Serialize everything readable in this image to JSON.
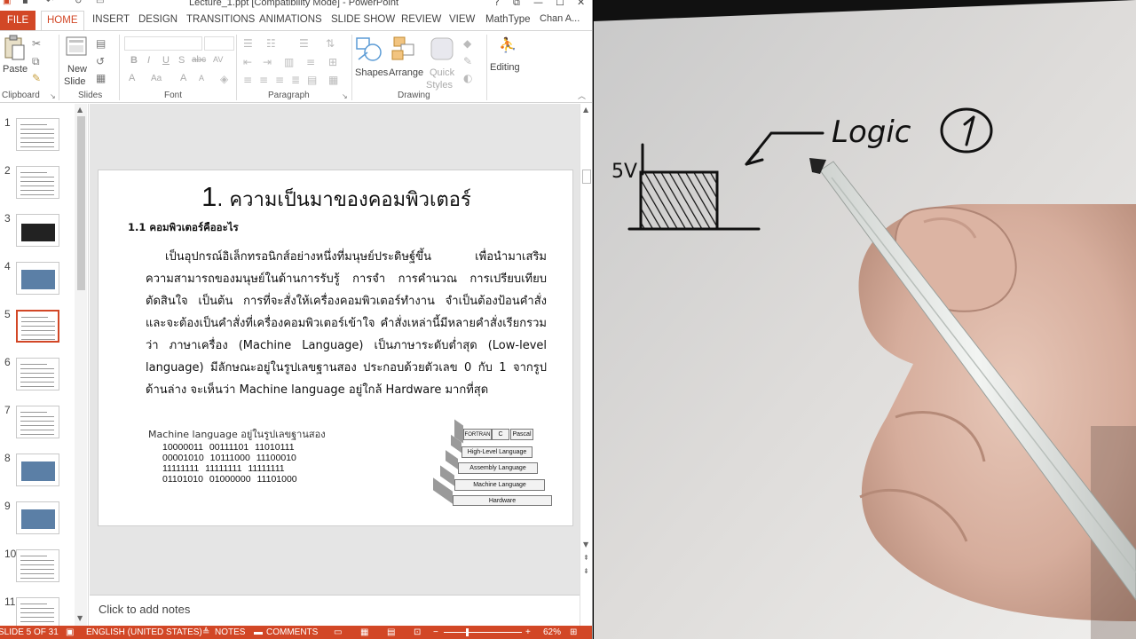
{
  "window": {
    "title": "Lecture_1.ppt [Compatibility Mode] - PowerPoint",
    "controls": {
      "help": "?",
      "restore_ribbon": "⧉",
      "minimize": "—",
      "maximize": "☐",
      "close": "✕"
    }
  },
  "tabs": {
    "file": "FILE",
    "home": "HOME",
    "insert": "INSERT",
    "design": "DESIGN",
    "transitions": "TRANSITIONS",
    "animations": "ANIMATIONS",
    "slide_show": "SLIDE SHOW",
    "review": "REVIEW",
    "view": "VIEW",
    "mathtype": "MathType",
    "user": "Chan A..."
  },
  "ribbon": {
    "clipboard": {
      "paste": "Paste",
      "label": "Clipboard"
    },
    "slides": {
      "new_slide_1": "New",
      "new_slide_2": "Slide",
      "label": "Slides"
    },
    "font": {
      "label": "Font",
      "bold": "B",
      "italic": "I",
      "underline": "U",
      "shadow": "S",
      "strike": "abc",
      "spacing": "AV",
      "case": "Aa",
      "grow": "A",
      "shrink": "A"
    },
    "paragraph": {
      "label": "Paragraph"
    },
    "drawing": {
      "shapes": "Shapes",
      "arrange": "Arrange",
      "quick_styles_1": "Quick",
      "quick_styles_2": "Styles",
      "label": "Drawing"
    },
    "editing": {
      "label": "Editing"
    }
  },
  "thumbnails": [
    {
      "n": "1"
    },
    {
      "n": "2"
    },
    {
      "n": "3"
    },
    {
      "n": "4"
    },
    {
      "n": "5"
    },
    {
      "n": "6"
    },
    {
      "n": "7"
    },
    {
      "n": "8"
    },
    {
      "n": "9"
    },
    {
      "n": "10"
    },
    {
      "n": "11"
    }
  ],
  "active_slide": 5,
  "slide": {
    "title_num": "1",
    "title_text": ". ความเป็นมาของคอมพิวเตอร์",
    "subtitle": "1.1 คอมพิวเตอร์คืออะไร",
    "para_lines": [
      "เป็นอุปกรณ์อิเล็กทรอนิกส์อย่างหนึ่งที่มนุษย์ประดิษฐ์ขึ้น        เพื่อนำมาเสริม",
      "ความสามารถของมนุษย์ในด้านการรับรู้  การจำ  การคำนวณ  การเปรียบเทียบ",
      "ตัดสินใจ  เป็นต้น  การที่จะสั่งให้เครื่องคอมพิวเตอร์ทำงาน  จำเป็นต้องป้อนคำสั่ง",
      "และจะต้องเป็นคำสั่งที่เครื่องคอมพิวเตอร์เข้าใจ  คำสั่งเหล่านี้มีหลายคำสั่งเรียกรวม",
      "ว่า  ภาษาเครื่อง  (Machine Language)  เป็นภาษาระดับต่ำสุด  (Low-level",
      "language) มีลักษณะอยู่ในรูปเลขฐานสอง ประกอบด้วยตัวเลข 0 กับ 1 จากรูป",
      "ด้านล่าง จะเห็นว่า Machine language อยู่ใกล้ Hardware มากที่สุด"
    ],
    "ml_title": "Machine language อยู่ในรูปเลขฐานสอง",
    "ml_rows": [
      "10000011 00111101 11010111",
      "00001010 10111000 11100010",
      "11111111 11111111 11111111",
      "01101010 01000000 11101000"
    ],
    "pyramid": {
      "top": [
        "FORTRAN",
        "C",
        "Pascal"
      ],
      "high": "High-Level Language",
      "assembly": "Assembly Language",
      "machine": "Machine Language",
      "hardware": "Hardware"
    }
  },
  "notes_placeholder": "Click to add notes",
  "status": {
    "slide": "SLIDE 5 OF 31",
    "language": "ENGLISH (UNITED STATES)",
    "notes": "NOTES",
    "comments": "COMMENTS",
    "zoom": "62%"
  },
  "camera": {
    "handwriting_logic": "Logic",
    "handwriting_circle": "1",
    "handwriting_voltage": "5V"
  },
  "colors": {
    "accent": "#d24726",
    "slide_bg": "#ffffff",
    "editor_bg": "#e5e5e5"
  }
}
